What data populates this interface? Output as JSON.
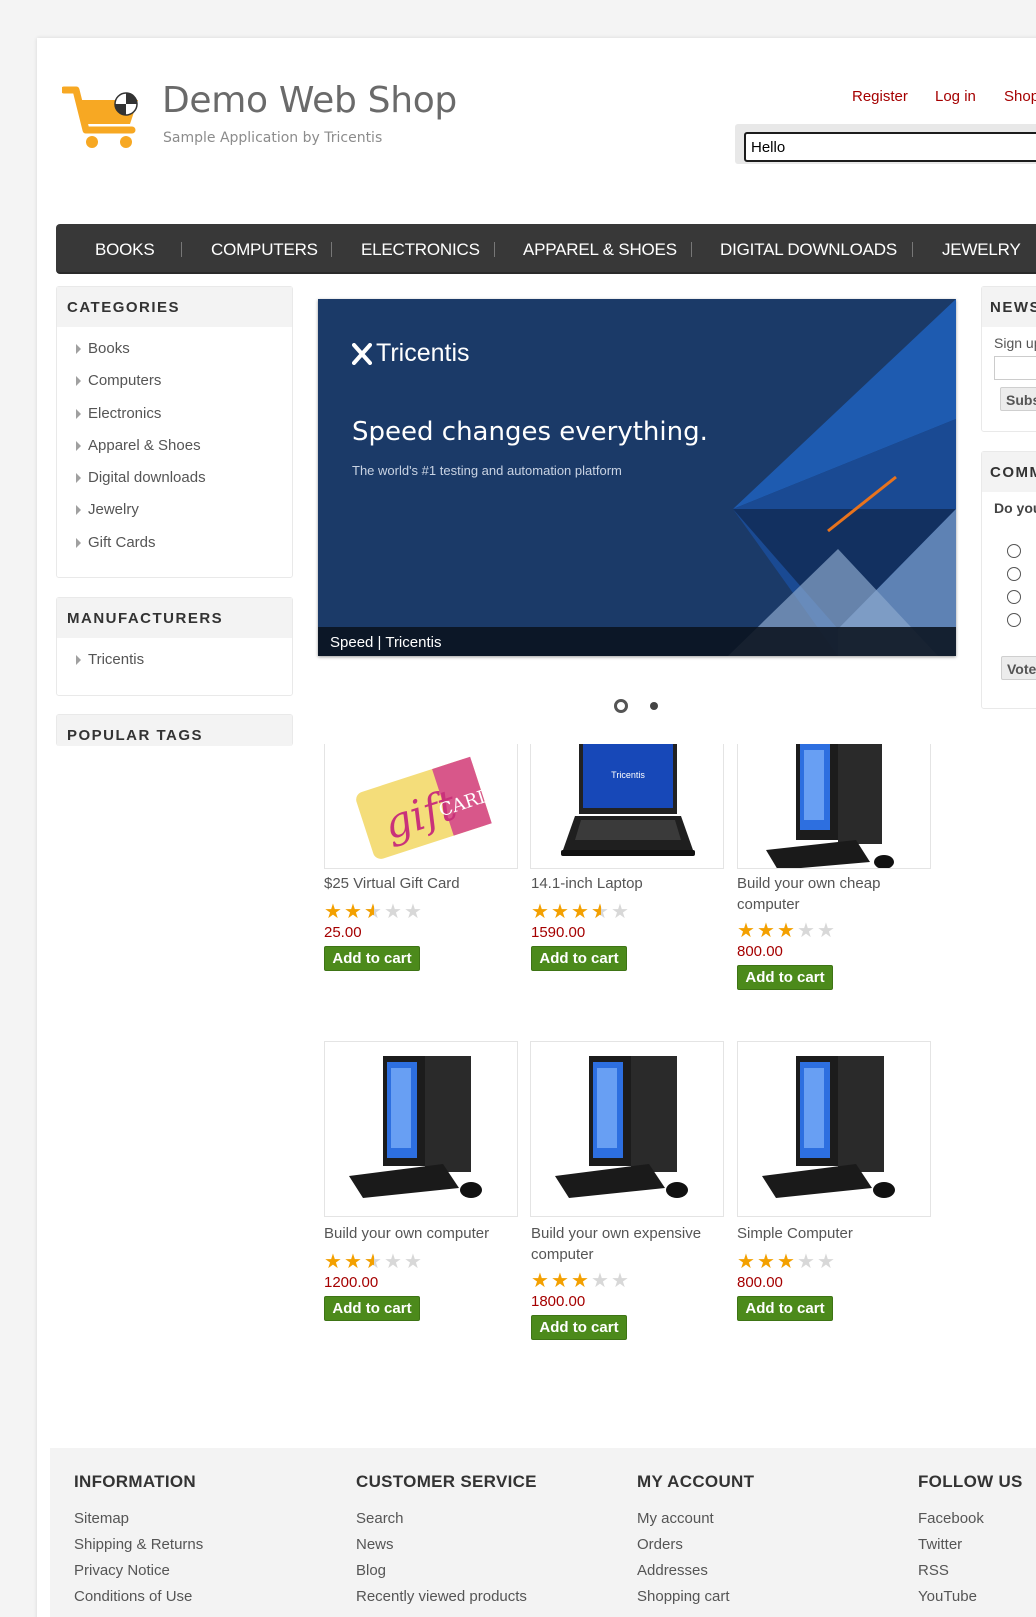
{
  "header": {
    "logo_title": "Demo Web Shop",
    "logo_subtitle": "Sample Application by Tricentis",
    "links": [
      "Register",
      "Log in",
      "Shop"
    ],
    "search_value": "Hello"
  },
  "top_menu": [
    "BOOKS",
    "COMPUTERS",
    "ELECTRONICS",
    "APPAREL & SHOES",
    "DIGITAL DOWNLOADS",
    "JEWELRY"
  ],
  "categories": {
    "title": "CATEGORIES",
    "items": [
      "Books",
      "Computers",
      "Electronics",
      "Apparel & Shoes",
      "Digital downloads",
      "Jewelry",
      "Gift Cards"
    ]
  },
  "manufacturers": {
    "title": "MANUFACTURERS",
    "items": [
      "Tricentis"
    ]
  },
  "popular_tags": {
    "title": "POPULAR TAGS"
  },
  "slider": {
    "brand": "Tricentis",
    "headline": "Speed changes everything.",
    "subline": "The world's #1 testing and automation platform",
    "caption": "Speed | Tricentis"
  },
  "newsletter": {
    "title": "NEWS",
    "signup": "Sign up",
    "button": "Subs"
  },
  "community_poll": {
    "title": "COMM",
    "question": "Do you",
    "button": "Vote"
  },
  "products": [
    {
      "name": "$25 Virtual Gift Card",
      "price": "25.00",
      "rating": 2.5,
      "button": "Add to cart",
      "image": "gift-card"
    },
    {
      "name": "14.1-inch Laptop",
      "price": "1590.00",
      "rating": 3.5,
      "button": "Add to cart",
      "image": "laptop"
    },
    {
      "name": "Build your own cheap computer",
      "price": "800.00",
      "rating": 3,
      "button": "Add to cart",
      "image": "desktop"
    },
    {
      "name": "Build your own computer",
      "price": "1200.00",
      "rating": 2.5,
      "button": "Add to cart",
      "image": "desktop"
    },
    {
      "name": "Build your own expensive computer",
      "price": "1800.00",
      "rating": 3,
      "button": "Add to cart",
      "image": "desktop"
    },
    {
      "name": "Simple Computer",
      "price": "800.00",
      "rating": 3,
      "button": "Add to cart",
      "image": "desktop"
    }
  ],
  "footer": {
    "information": {
      "title": "INFORMATION",
      "links": [
        "Sitemap",
        "Shipping & Returns",
        "Privacy Notice",
        "Conditions of Use"
      ]
    },
    "customer_service": {
      "title": "CUSTOMER SERVICE",
      "links": [
        "Search",
        "News",
        "Blog",
        "Recently viewed products"
      ]
    },
    "my_account": {
      "title": "MY ACCOUNT",
      "links": [
        "My account",
        "Orders",
        "Addresses",
        "Shopping cart"
      ]
    },
    "follow_us": {
      "title": "FOLLOW US",
      "links": [
        "Facebook",
        "Twitter",
        "RSS",
        "YouTube"
      ]
    }
  },
  "colors": {
    "link_red": "#a50000",
    "menu_bg": "#383838",
    "button_green": "#4c8a1b",
    "star_on": "#f3a000",
    "slider_bg": "#1b3a68"
  }
}
